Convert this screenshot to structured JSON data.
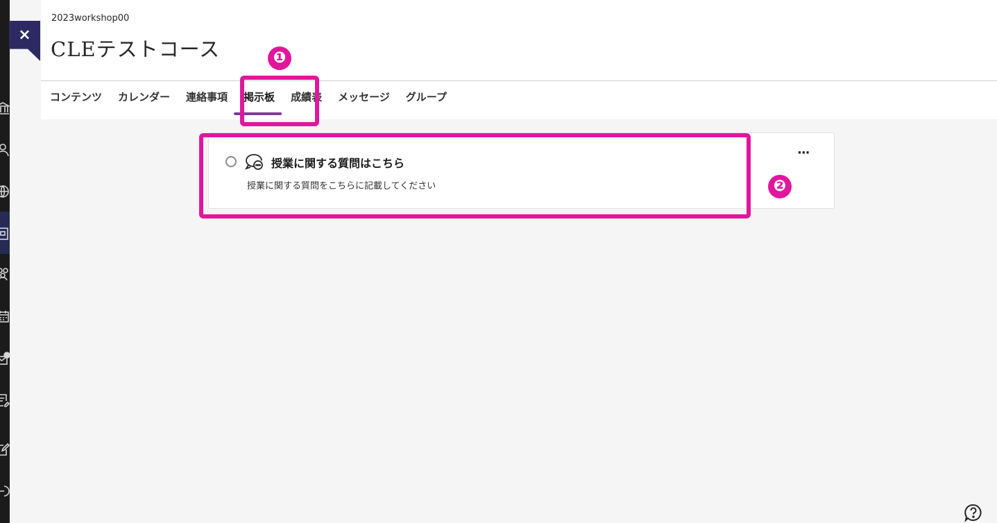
{
  "header": {
    "course_id": "2023workshop00",
    "course_title": "CLEテストコース"
  },
  "close": {
    "label": "×"
  },
  "tabs": [
    {
      "label": "コンテンツ"
    },
    {
      "label": "カレンダー"
    },
    {
      "label": "連絡事項"
    },
    {
      "label": "掲示板"
    },
    {
      "label": "成績表"
    },
    {
      "label": "メッセージ"
    },
    {
      "label": "グループ"
    }
  ],
  "active_tab": "掲示板",
  "discussion": {
    "title": "授業に関する質問はこちら",
    "description": "授業に関する質問をこちらに記載してください",
    "more_label": "···"
  },
  "annotations": {
    "step1": "❶",
    "step2": "❷",
    "color": "#e0179d"
  },
  "rail_icons": [
    "institution-icon",
    "profile-icon",
    "globe-icon",
    "courses-icon",
    "groups-icon",
    "calendar-icon",
    "messages-icon",
    "grades-icon",
    "tools-icon",
    "signout-icon"
  ],
  "colors": {
    "rail": "#1b1b1b",
    "close_button": "#2d2a63",
    "active_tab_underline": "#7d3c98"
  }
}
